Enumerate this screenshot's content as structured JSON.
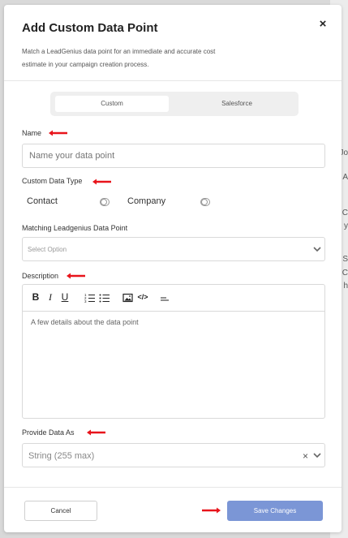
{
  "modal": {
    "title": "Add Custom Data Point",
    "subtitle": "Match a LeadGenius data point for an immediate and accurate cost estimate in your campaign creation process.",
    "close_icon": "×"
  },
  "tabs": [
    {
      "label": "Custom",
      "active": true
    },
    {
      "label": "Salesforce",
      "active": false
    }
  ],
  "name": {
    "label": "Name",
    "placeholder": "Name your data point"
  },
  "data_type": {
    "label": "Custom Data Type",
    "options": [
      {
        "label": "Contact",
        "toggled": false
      },
      {
        "label": "Company",
        "toggled": false
      }
    ]
  },
  "matching": {
    "label": "Matching Leadgenius Data Point",
    "placeholder": "Select Option"
  },
  "description": {
    "label": "Description",
    "placeholder": "A few details about the data point",
    "toolbar": {
      "bold": "B",
      "italic": "I",
      "underline": "U",
      "ordered_list": "ordered-list-icon",
      "bullet_list": "bullet-list-icon",
      "image": "image-icon",
      "code": "</>",
      "align": "align-icon"
    }
  },
  "provide_as": {
    "label": "Provide Data As",
    "value": "String (255 max)",
    "clear": "×"
  },
  "footer": {
    "cancel": "Cancel",
    "save": "Save Changes"
  },
  "annotation_color": "#e8141b",
  "save_color": "#7b96d6",
  "background_fragments": [
    "Jo",
    "A",
    "C",
    "y",
    "S",
    "C",
    "h"
  ]
}
